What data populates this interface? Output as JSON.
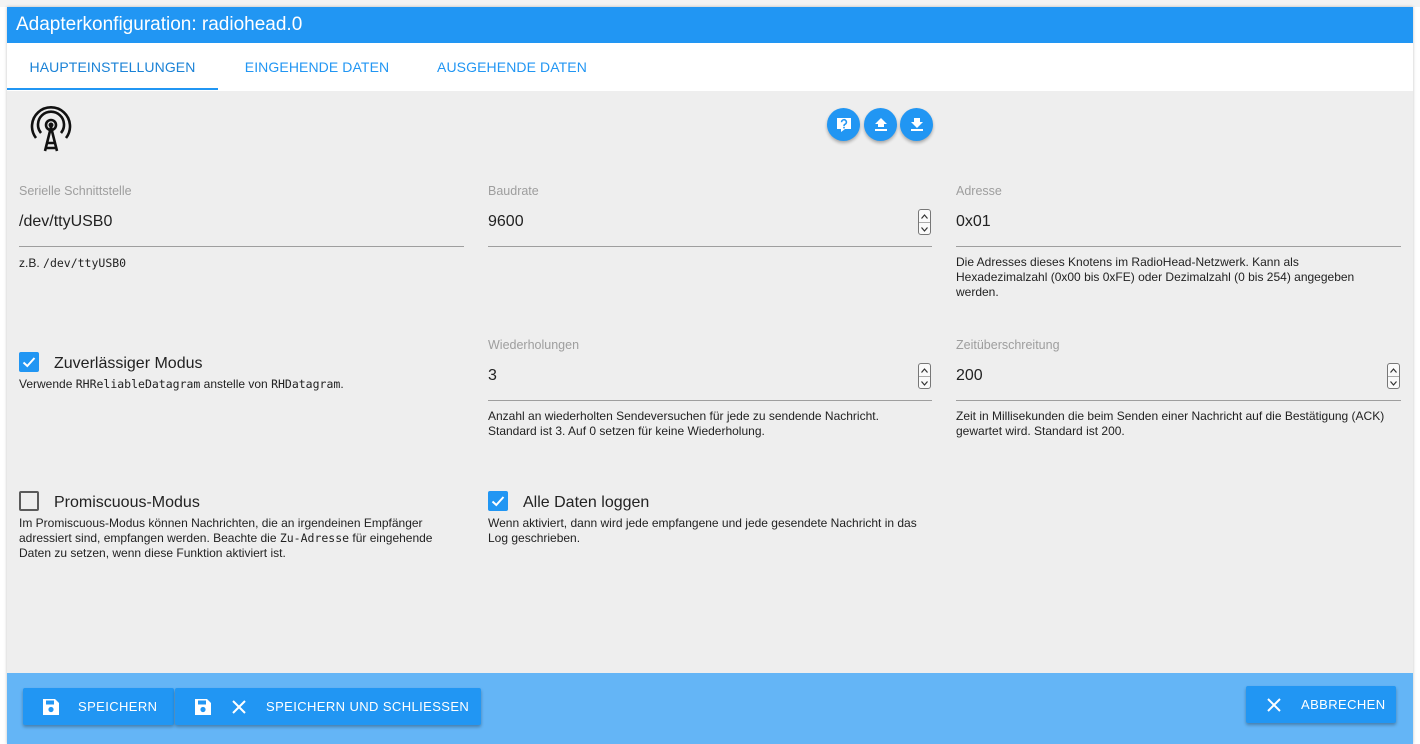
{
  "window": {
    "title": "Adapterkonfiguration: radiohead.0"
  },
  "tabs": [
    {
      "label": "HAUPTEINSTELLUNGEN"
    },
    {
      "label": "EINGEHENDE DATEN"
    },
    {
      "label": "AUSGEHENDE DATEN"
    }
  ],
  "toolbar_icons": [
    "help-icon",
    "upload-icon",
    "download-icon"
  ],
  "serial": {
    "label": "Serielle Schnittstelle",
    "value": "/dev/ttyUSB0",
    "helper_prefix": "z.B. ",
    "helper_code": "/dev/ttyUSB0"
  },
  "baudrate": {
    "label": "Baudrate",
    "value": "9600"
  },
  "address": {
    "label": "Adresse",
    "value": "0x01",
    "helper": "Die Adresses dieses Knotens im RadioHead-Netzwerk. Kann als Hexadezimalzahl (0x00 bis 0xFE) oder Dezimalzahl (0 bis 254) angegeben werden."
  },
  "reliable": {
    "checked": true,
    "label": "Zuverlässiger Modus",
    "helper_1": "Verwende ",
    "helper_code_1": "RHReliableDatagram",
    "helper_2": " anstelle von ",
    "helper_code_2": "RHDatagram",
    "helper_3": "."
  },
  "retries": {
    "label": "Wiederholungen",
    "value": "3",
    "helper": "Anzahl an wiederholten Sendeversuchen für jede zu sendende Nachricht. Standard ist 3. Auf 0 setzen für keine Wiederholung."
  },
  "timeout": {
    "label": "Zeitüberschreitung",
    "value": "200",
    "helper": "Zeit in Millisekunden die beim Senden einer Nachricht auf die Bestätigung (ACK) gewartet wird. Standard ist 200."
  },
  "promiscuous": {
    "checked": false,
    "label": "Promiscuous-Modus",
    "helper_1": "Im Promiscuous-Modus können Nachrichten, die an irgendeinen Empfänger adressiert sind, empfangen werden. Beachte die ",
    "helper_code": "Zu-Adresse",
    "helper_2": " für eingehende Daten zu setzen, wenn diese Funktion aktiviert ist."
  },
  "log_all": {
    "checked": true,
    "label": "Alle Daten loggen",
    "helper": "Wenn aktiviert, dann wird jede empfangene und jede gesendete Nachricht in das Log geschrieben."
  },
  "footer": {
    "save_label": "SPEICHERN",
    "save_close_label": "SPEICHERN UND SCHLIESSEN",
    "cancel_label": "ABBRECHEN"
  },
  "colors": {
    "primary": "#2196f3",
    "bottom_bar": "#64b5f6",
    "background": "#eeeeee"
  }
}
